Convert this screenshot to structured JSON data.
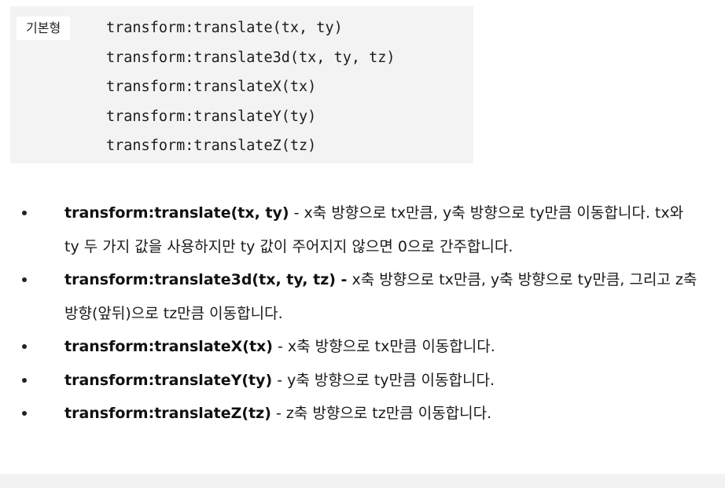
{
  "syntax": {
    "tag": "기본형",
    "lines": [
      "transform:translate(tx, ty)",
      "transform:translate3d(tx, ty, tz)",
      "transform:translateX(tx)",
      "transform:translateY(ty)",
      "transform:translateZ(tz)"
    ]
  },
  "bullets": [
    {
      "title": "transform:translate(tx, ty)",
      "text": " - x축 방향으로 tx만큼, y축 방향으로 ty만큼 이동합니다. tx와 ty 두 가지 값을 사용하지만 ty 값이 주어지지 않으면 0으로 간주합니다."
    },
    {
      "title": "transform:translate3d(tx, ty, tz) -",
      "text": " x축 방향으로 tx만큼, y축 방향으로 ty만큼, 그리고 z축 방향(앞뒤)으로 tz만큼 이동합니다."
    },
    {
      "title": "transform:translateX(tx)",
      "text": " - x축 방향으로 tx만큼 이동합니다."
    },
    {
      "title": "transform:translateY(ty)",
      "text": " - y축 방향으로 ty만큼 이동합니다."
    },
    {
      "title": "transform:translateZ(tz)",
      "text": " - z축 방향으로 tz만큼 이동합니다."
    }
  ]
}
